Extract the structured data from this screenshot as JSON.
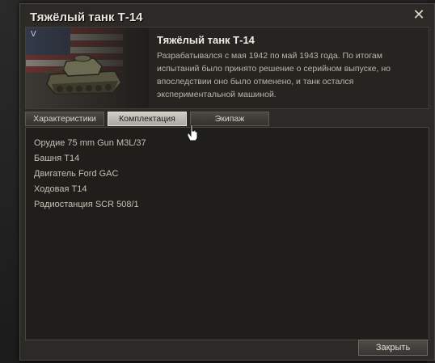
{
  "window": {
    "title": "Тяжёлый танк Т-14",
    "close_icon": "close-icon"
  },
  "tank": {
    "tier": "V",
    "name": "Тяжёлый танк Т-14",
    "description": "Разрабатывался с мая 1942 по май 1943 года. По итогам испытаний было принято решение о серийном выпуске, но впоследствии оно было отменено, и танк остался экспериментальной машиной.",
    "nation_flag": "usa-flag",
    "image": "tank-t14-image"
  },
  "tabs": [
    {
      "label": "Характеристики",
      "active": false
    },
    {
      "label": "Комплектация",
      "active": true
    },
    {
      "label": "Экипаж",
      "active": false
    }
  ],
  "equipment": [
    "Орудие 75 mm Gun M3L/37",
    "Башня T14",
    "Двигатель Ford GAC",
    "Ходовая T14",
    "Радиостанция SCR 508/1"
  ],
  "footer": {
    "close_label": "Закрыть"
  },
  "colors": {
    "accent": "#d6d4cc",
    "active_tab": "#cfcdc5",
    "panel": "#1f1e1b"
  }
}
